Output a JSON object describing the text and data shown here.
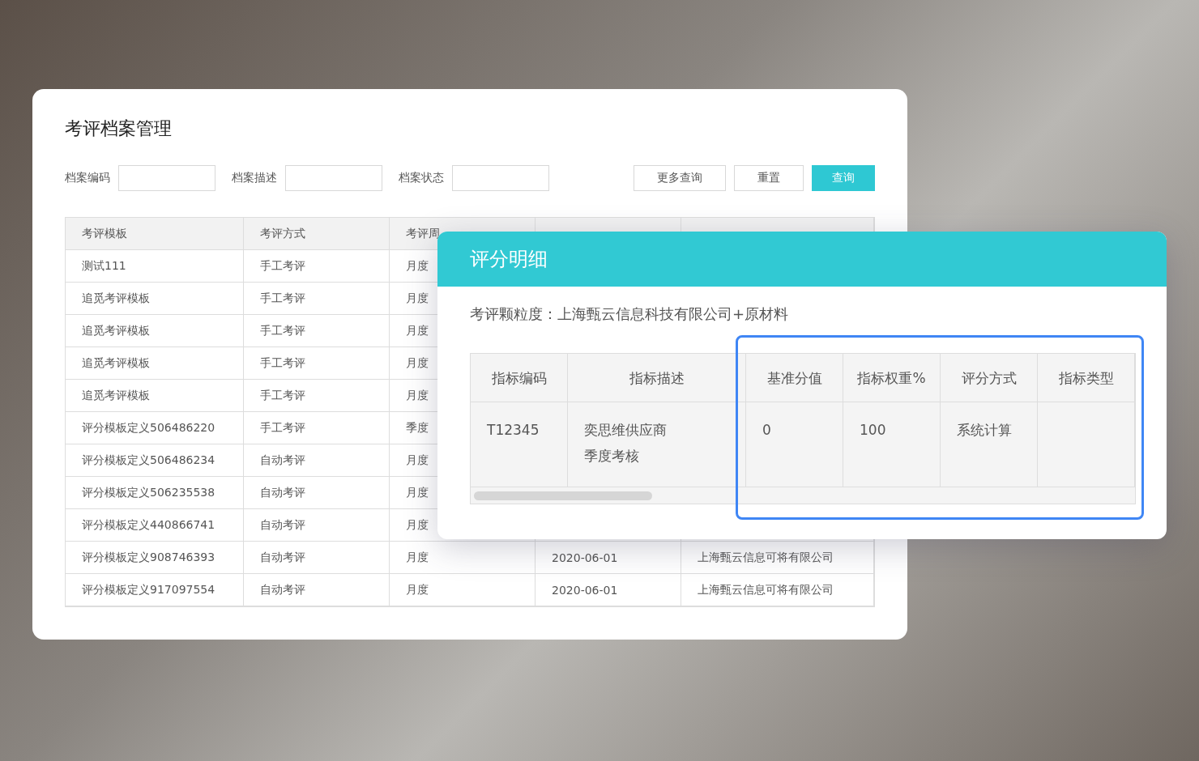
{
  "page": {
    "title": "考评档案管理"
  },
  "filters": [
    {
      "label": "档案编码"
    },
    {
      "label": "档案描述"
    },
    {
      "label": "档案状态"
    }
  ],
  "buttons": [
    {
      "label": "更多查询",
      "kind": "default"
    },
    {
      "label": "重置",
      "kind": "default"
    },
    {
      "label": "查询",
      "kind": "primary"
    }
  ],
  "table": {
    "columns": [
      "考评模板",
      "考评方式",
      "考评周"
    ],
    "rows": [
      {
        "cells": [
          "测试111",
          "手工考评",
          "月度"
        ]
      },
      {
        "cells": [
          "追觅考评模板",
          "手工考评",
          "月度"
        ]
      },
      {
        "cells": [
          "追觅考评模板",
          "手工考评",
          "月度"
        ]
      },
      {
        "cells": [
          "追觅考评模板",
          "手工考评",
          "月度"
        ]
      },
      {
        "cells": [
          "追觅考评模板",
          "手工考评",
          "月度"
        ]
      },
      {
        "cells": [
          "评分模板定义506486220",
          "手工考评",
          "季度"
        ]
      },
      {
        "cells": [
          "评分模板定义506486234",
          "自动考评",
          "月度"
        ]
      },
      {
        "cells": [
          "评分模板定义506235538",
          "自动考评",
          "月度"
        ]
      },
      {
        "cells": [
          "评分模板定义440866741",
          "自动考评",
          "月度"
        ]
      },
      {
        "cells": [
          "评分模板定义908746393",
          "自动考评",
          "月度",
          "2020-06-01",
          "上海甄云信息可将有限公司"
        ]
      },
      {
        "cells": [
          "评分模板定义917097554",
          "自动考评",
          "月度",
          "2020-06-01",
          "上海甄云信息可将有限公司"
        ]
      }
    ]
  },
  "dialog": {
    "title": "评分明细",
    "granularity": "考评颗粒度：上海甄云信息科技有限公司+原材料",
    "columns": [
      "指标编码",
      "指标描述",
      "基准分值",
      "指标权重%",
      "评分方式",
      "指标类型"
    ],
    "rows": [
      {
        "cells": [
          "T12345",
          [
            "奕思维供应商",
            "季度考核"
          ],
          "0",
          "100",
          "系统计算",
          ""
        ]
      }
    ]
  }
}
